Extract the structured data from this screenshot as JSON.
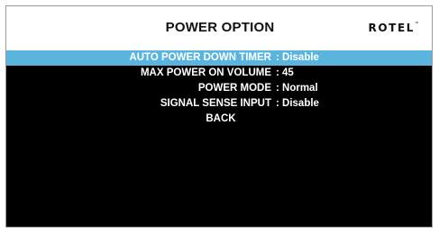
{
  "header": {
    "title": "POWER OPTION",
    "logo_text": "ROTEL",
    "logo_mark": "™"
  },
  "menu": {
    "selected_color": "#5ab4de",
    "items": [
      {
        "label": "AUTO POWER DOWN TIMER",
        "value": " : Disable",
        "selected": true
      },
      {
        "label": "MAX POWER ON VOLUME",
        "value": " : 45",
        "selected": false
      },
      {
        "label": "POWER MODE",
        "value": " : Normal",
        "selected": false
      },
      {
        "label": "SIGNAL SENSE INPUT",
        "value": " : Disable",
        "selected": false
      }
    ],
    "back_label": "BACK"
  }
}
